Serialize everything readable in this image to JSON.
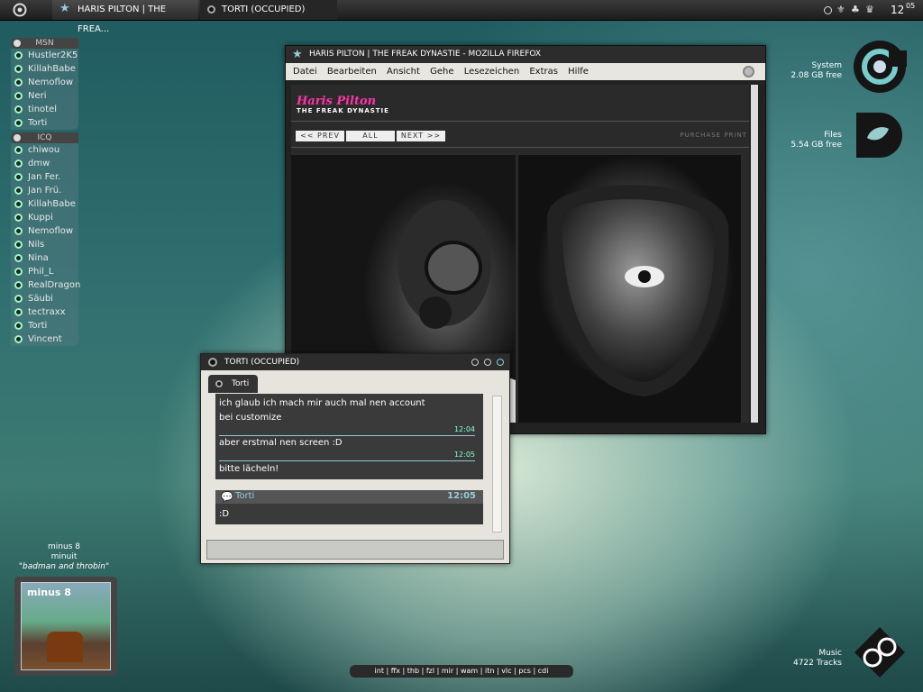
{
  "taskbar": {
    "tasks": [
      {
        "label": "HARIS PILTON | THE FREA..."
      },
      {
        "label": "TORTI (OCCUPIED)"
      }
    ],
    "clock": {
      "hour": "12",
      "minute": "05"
    }
  },
  "contacts": {
    "msn": {
      "header": "MSN",
      "items": [
        "Hustler2K5",
        "KillahBabe",
        "Nemoflow",
        "Neri",
        "tinotel",
        "Torti"
      ]
    },
    "icq": {
      "header": "ICQ",
      "items": [
        "chiwou",
        "dmw",
        "Jan Fer.",
        "Jan Frü.",
        "KillahBabe",
        "Kuppi",
        "Nemoflow",
        "Nils",
        "Nina",
        "Phil_L",
        "RealDragon",
        "Säubi",
        "tectraxx",
        "Torti",
        "Vincent"
      ]
    }
  },
  "drives": [
    {
      "name": "System",
      "free": "2.08 GB free"
    },
    {
      "name": "Files",
      "free": "5.54 GB free"
    }
  ],
  "music_widget": {
    "name": "Music",
    "tracks": "4722 Tracks"
  },
  "firefox": {
    "title": "HARIS PILTON | THE FREAK DYNASTIE - MOZILLA FIREFOX",
    "menu": [
      "Datei",
      "Bearbeiten",
      "Ansicht",
      "Gehe",
      "Lesezeichen",
      "Extras",
      "Hilfe"
    ],
    "site_title": "Haris Pilton",
    "site_subtitle": "THE FREAK DYNASTIE",
    "nav": {
      "prev": "<< PREV",
      "all": "ALL",
      "next": "NEXT >>"
    },
    "links": "PURCHASE PRINT"
  },
  "chat": {
    "title": "TORTI (OCCUPIED)",
    "tab": "Torti",
    "messages": [
      {
        "text": "ich glaub ich mach mir auch mal nen account bei customize",
        "time": "12:04"
      },
      {
        "text": "aber erstmal nen screen :D",
        "time": "12:05"
      },
      {
        "text": "bitte lächeln!",
        "time": ""
      }
    ],
    "reply": {
      "sender": "Torti",
      "time": "12:05",
      "text": ":D"
    }
  },
  "now_playing": {
    "artist": "minus 8",
    "album": "minuit",
    "track": "\"badman and throbin\"",
    "cover_text": "minus 8"
  },
  "quicklaunch": "int | ffx | thb | fzl | mir | wam | itn | vlc | pcs | cdi"
}
